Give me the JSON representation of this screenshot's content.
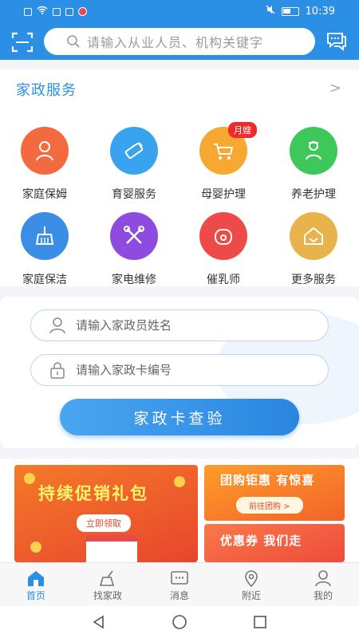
{
  "status_bar": {
    "time": "10:39"
  },
  "search": {
    "placeholder": "请输入从业人员、机构关键字"
  },
  "services": {
    "title": "家政服务",
    "items": [
      {
        "label": "家庭保姆",
        "icon": "nanny-icon",
        "color": "#f26a3d"
      },
      {
        "label": "育婴服务",
        "icon": "baby-bottle-icon",
        "color": "#3aa3ef"
      },
      {
        "label": "母婴护理",
        "icon": "stroller-icon",
        "color": "#f6a830",
        "badge": "月嫂"
      },
      {
        "label": "养老护理",
        "icon": "elder-care-icon",
        "color": "#3ec85a"
      },
      {
        "label": "家庭保洁",
        "icon": "broom-icon",
        "color": "#3b8ee6"
      },
      {
        "label": "家电维修",
        "icon": "tools-icon",
        "color": "#8e4be0"
      },
      {
        "label": "催乳师",
        "icon": "lactation-icon",
        "color": "#ef4a4a"
      },
      {
        "label": "更多服务",
        "icon": "house-more-icon",
        "color": "#e8b34a"
      }
    ]
  },
  "card_check": {
    "name_placeholder": "请输入家政员姓名",
    "card_placeholder": "请输入家政卡编号",
    "button_label": "家政卡查验"
  },
  "promos": {
    "main": {
      "title": "持续促销礼包",
      "button": "立即领取"
    },
    "side1": {
      "title": "团购钜惠 有惊喜",
      "button": "前往团购 >"
    },
    "side2": {
      "title": "优惠券 我们走"
    }
  },
  "tabs": [
    {
      "label": "首页",
      "icon": "home-icon",
      "active": true
    },
    {
      "label": "找家政",
      "icon": "broom-search-icon",
      "active": false
    },
    {
      "label": "消息",
      "icon": "message-icon",
      "active": false
    },
    {
      "label": "附近",
      "icon": "location-icon",
      "active": false
    },
    {
      "label": "我的",
      "icon": "profile-icon",
      "active": false
    }
  ],
  "colors": {
    "primary": "#2c8fe6",
    "accent_red": "#ee2a2a"
  }
}
